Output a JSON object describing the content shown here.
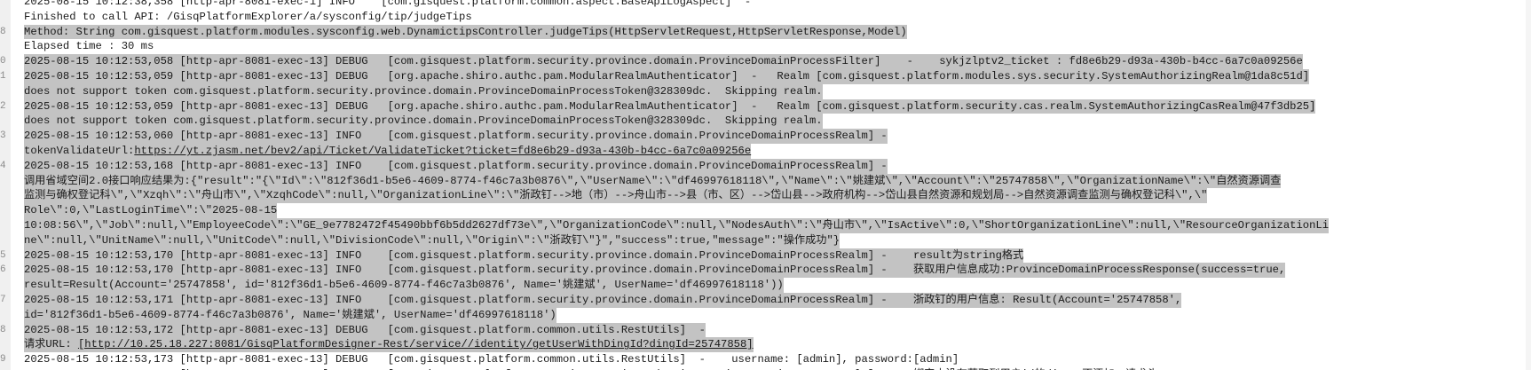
{
  "editor": {
    "lines": [
      {
        "ln": "",
        "sel": false,
        "segs": [
          {
            "t": "2025-08-15 10:12:38,358 [http-apr-8081-exec-1] INFO    [com.gisquest.platform.common.aspect.BaseApiLogAspect]  -"
          }
        ]
      },
      {
        "ln": "",
        "sel": false,
        "segs": [
          {
            "t": "Finished to call API: /GisqPlatformExplorer/a/sysconfig/tip/judgeTips"
          }
        ]
      },
      {
        "ln": "8",
        "sel": true,
        "segs": [
          {
            "t": "Method: String com.gisquest.platform.modules.sysconfig.web.DynamictipsController.judgeTips(HttpServletRequest,HttpServletResponse,Model)"
          }
        ]
      },
      {
        "ln": "",
        "sel": false,
        "segs": [
          {
            "t": "Elapsed time : 30 ms"
          }
        ]
      },
      {
        "ln": "0",
        "sel": true,
        "segs": [
          {
            "t": "2025-08-15 10:12:53,058 [http-apr-8081-exec-13] DEBUG   [com.gisquest.platform.security.province.domain.ProvinceDomainProcessFilter]    -    sykjzlptv2_ticket : fd8e6b29-d93a-430b-b4cc-6a7c0a09256e"
          }
        ]
      },
      {
        "ln": "1",
        "sel": true,
        "segs": [
          {
            "t": "2025-08-15 10:12:53,059 [http-apr-8081-exec-13] DEBUG   [org.apache.shiro.authc.pam.ModularRealmAuthenticator]  -   Realm [com.gisquest.platform.modules.sys.security.SystemAuthorizingRealm@1da8c51d]"
          }
        ]
      },
      {
        "ln": "",
        "sel": true,
        "segs": [
          {
            "t": "does not support token com.gisquest.platform.security.province.domain.ProvinceDomainProcessToken@328309dc.  Skipping realm."
          }
        ]
      },
      {
        "ln": "2",
        "sel": true,
        "segs": [
          {
            "t": "2025-08-15 10:12:53,059 [http-apr-8081-exec-13] DEBUG   [org.apache.shiro.authc.pam.ModularRealmAuthenticator]  -   Realm [com.gisquest.platform.security.cas.realm.SystemAuthorizingCasRealm@47f3db25]"
          }
        ]
      },
      {
        "ln": "",
        "sel": true,
        "segs": [
          {
            "t": "does not support token com.gisquest.platform.security.province.domain.ProvinceDomainProcessToken@328309dc.  Skipping realm."
          }
        ]
      },
      {
        "ln": "3",
        "sel": true,
        "segs": [
          {
            "t": "2025-08-15 10:12:53,060 [http-apr-8081-exec-13] INFO    [com.gisquest.platform.security.province.domain.ProvinceDomainProcessRealm] -"
          }
        ]
      },
      {
        "ln": "",
        "sel": true,
        "segs": [
          {
            "t": "tokenValidateUrl:"
          },
          {
            "t": "https://yt.zjasm.net/bev2/api/Ticket/ValidateTicket?ticket=fd8e6b29-d93a-430b-b4cc-6a7c0a09256e",
            "link": true
          }
        ]
      },
      {
        "ln": "4",
        "sel": true,
        "segs": [
          {
            "t": "2025-08-15 10:12:53,168 [http-apr-8081-exec-13] INFO    [com.gisquest.platform.security.province.domain.ProvinceDomainProcessRealm] -"
          }
        ]
      },
      {
        "ln": "",
        "sel": true,
        "segs": [
          {
            "t": "调用省域空间2.0接口响应结果为:{\"result\":\"{\\\"Id\\\":\\\"812f36d1-b5e6-4609-8774-f46c7a3b0876\\\",\\\"UserName\\\":\\\"df46997618118\\\",\\\"Name\\\":\\\"姚建斌\\\",\\\"Account\\\":\\\"25747858\\\",\\\"OrganizationName\\\":\\\"自然资源调查"
          }
        ]
      },
      {
        "ln": "",
        "sel": true,
        "segs": [
          {
            "t": "监测与确权登记科\\\",\\\"Xzqh\\\":\\\"舟山市\\\",\\\"XzqhCode\\\":null,\\\"OrganizationLine\\\":\\\"浙政钉-->地（市）-->舟山市-->县（市、区）-->岱山县-->政府机构-->岱山县自然资源和规划局-->自然资源调查监测与确权登记科\\\",\\\""
          }
        ]
      },
      {
        "ln": "",
        "sel": true,
        "segs": [
          {
            "t": "Role\\\":0,\\\"LastLoginTime\\\":\\\"2025-08-15"
          }
        ]
      },
      {
        "ln": "",
        "sel": true,
        "segs": [
          {
            "t": "10:08:56\\\",\\\"Job\\\":null,\\\"EmployeeCode\\\":\\\"GE_9e7782472f45490bbf6b5dd2627df73e\\\",\\\"OrganizationCode\\\":null,\\\"NodesAuth\\\":\\\"舟山市\\\",\\\"IsActive\\\":0,\\\"ShortOrganizationLine\\\":null,\\\"ResourceOrganizationLi"
          }
        ]
      },
      {
        "ln": "",
        "sel": true,
        "segs": [
          {
            "t": "ne\\\":null,\\\"UnitName\\\":null,\\\"UnitCode\\\":null,\\\"DivisionCode\\\":null,\\\"Origin\\\":\\\"浙政钉\\\"}\",\"success\":true,\"message\":\"操作成功\"}"
          }
        ]
      },
      {
        "ln": "5",
        "sel": true,
        "segs": [
          {
            "t": "2025-08-15 10:12:53,170 [http-apr-8081-exec-13] INFO    [com.gisquest.platform.security.province.domain.ProvinceDomainProcessRealm] -    result为string格式"
          }
        ]
      },
      {
        "ln": "6",
        "sel": true,
        "segs": [
          {
            "t": "2025-08-15 10:12:53,170 [http-apr-8081-exec-13] INFO    [com.gisquest.platform.security.province.domain.ProvinceDomainProcessRealm] -    获取用户信息成功:ProvinceDomainProcessResponse(success=true,"
          }
        ]
      },
      {
        "ln": "",
        "sel": true,
        "segs": [
          {
            "t": "result=Result(Account='25747858', id='812f36d1-b5e6-4609-8774-f46c7a3b0876', Name='姚建斌', UserName='df46997618118'))"
          }
        ]
      },
      {
        "ln": "7",
        "sel": true,
        "segs": [
          {
            "t": "2025-08-15 10:12:53,171 [http-apr-8081-exec-13] INFO    [com.gisquest.platform.security.province.domain.ProvinceDomainProcessRealm] -    浙政钉的用户信息: Result(Account='25747858',"
          }
        ]
      },
      {
        "ln": "",
        "sel": true,
        "segs": [
          {
            "t": "id='812f36d1-b5e6-4609-8774-f46c7a3b0876', Name='姚建斌', UserName='df46997618118')"
          }
        ]
      },
      {
        "ln": "8",
        "sel": true,
        "segs": [
          {
            "t": "2025-08-15 10:12:53,172 [http-apr-8081-exec-13] DEBUG   [com.gisquest.platform.common.utils.RestUtils]  -"
          }
        ]
      },
      {
        "ln": "",
        "sel": true,
        "segs": [
          {
            "t": "请求URL: "
          },
          {
            "t": "[http://10.25.18.227:8081/GisqPlatformDesigner-Rest/service//identity/getUserWithDingId?dingId=25747858]",
            "link": true
          }
        ]
      },
      {
        "ln": "9",
        "sel": false,
        "segs": [
          {
            "t": "2025-08-15 10:12:53,173 [http-apr-8081-exec-13] DEBUG   [com.gisquest.platform.common.utils.RestUtils]  -    username: [admin], password:[admin]"
          }
        ]
      },
      {
        "ln": "",
        "sel": false,
        "segs": [
          {
            "t": "2025-08-15 10:12:53,174 [http-apr-8081-exec-13] DEBUG   [com.gisquest.platform.security.province.domain.ProvinceDomainProcessRealm] -    绑定中没有获取到用户id的ding，不添加，请求头"
          }
        ]
      }
    ]
  }
}
